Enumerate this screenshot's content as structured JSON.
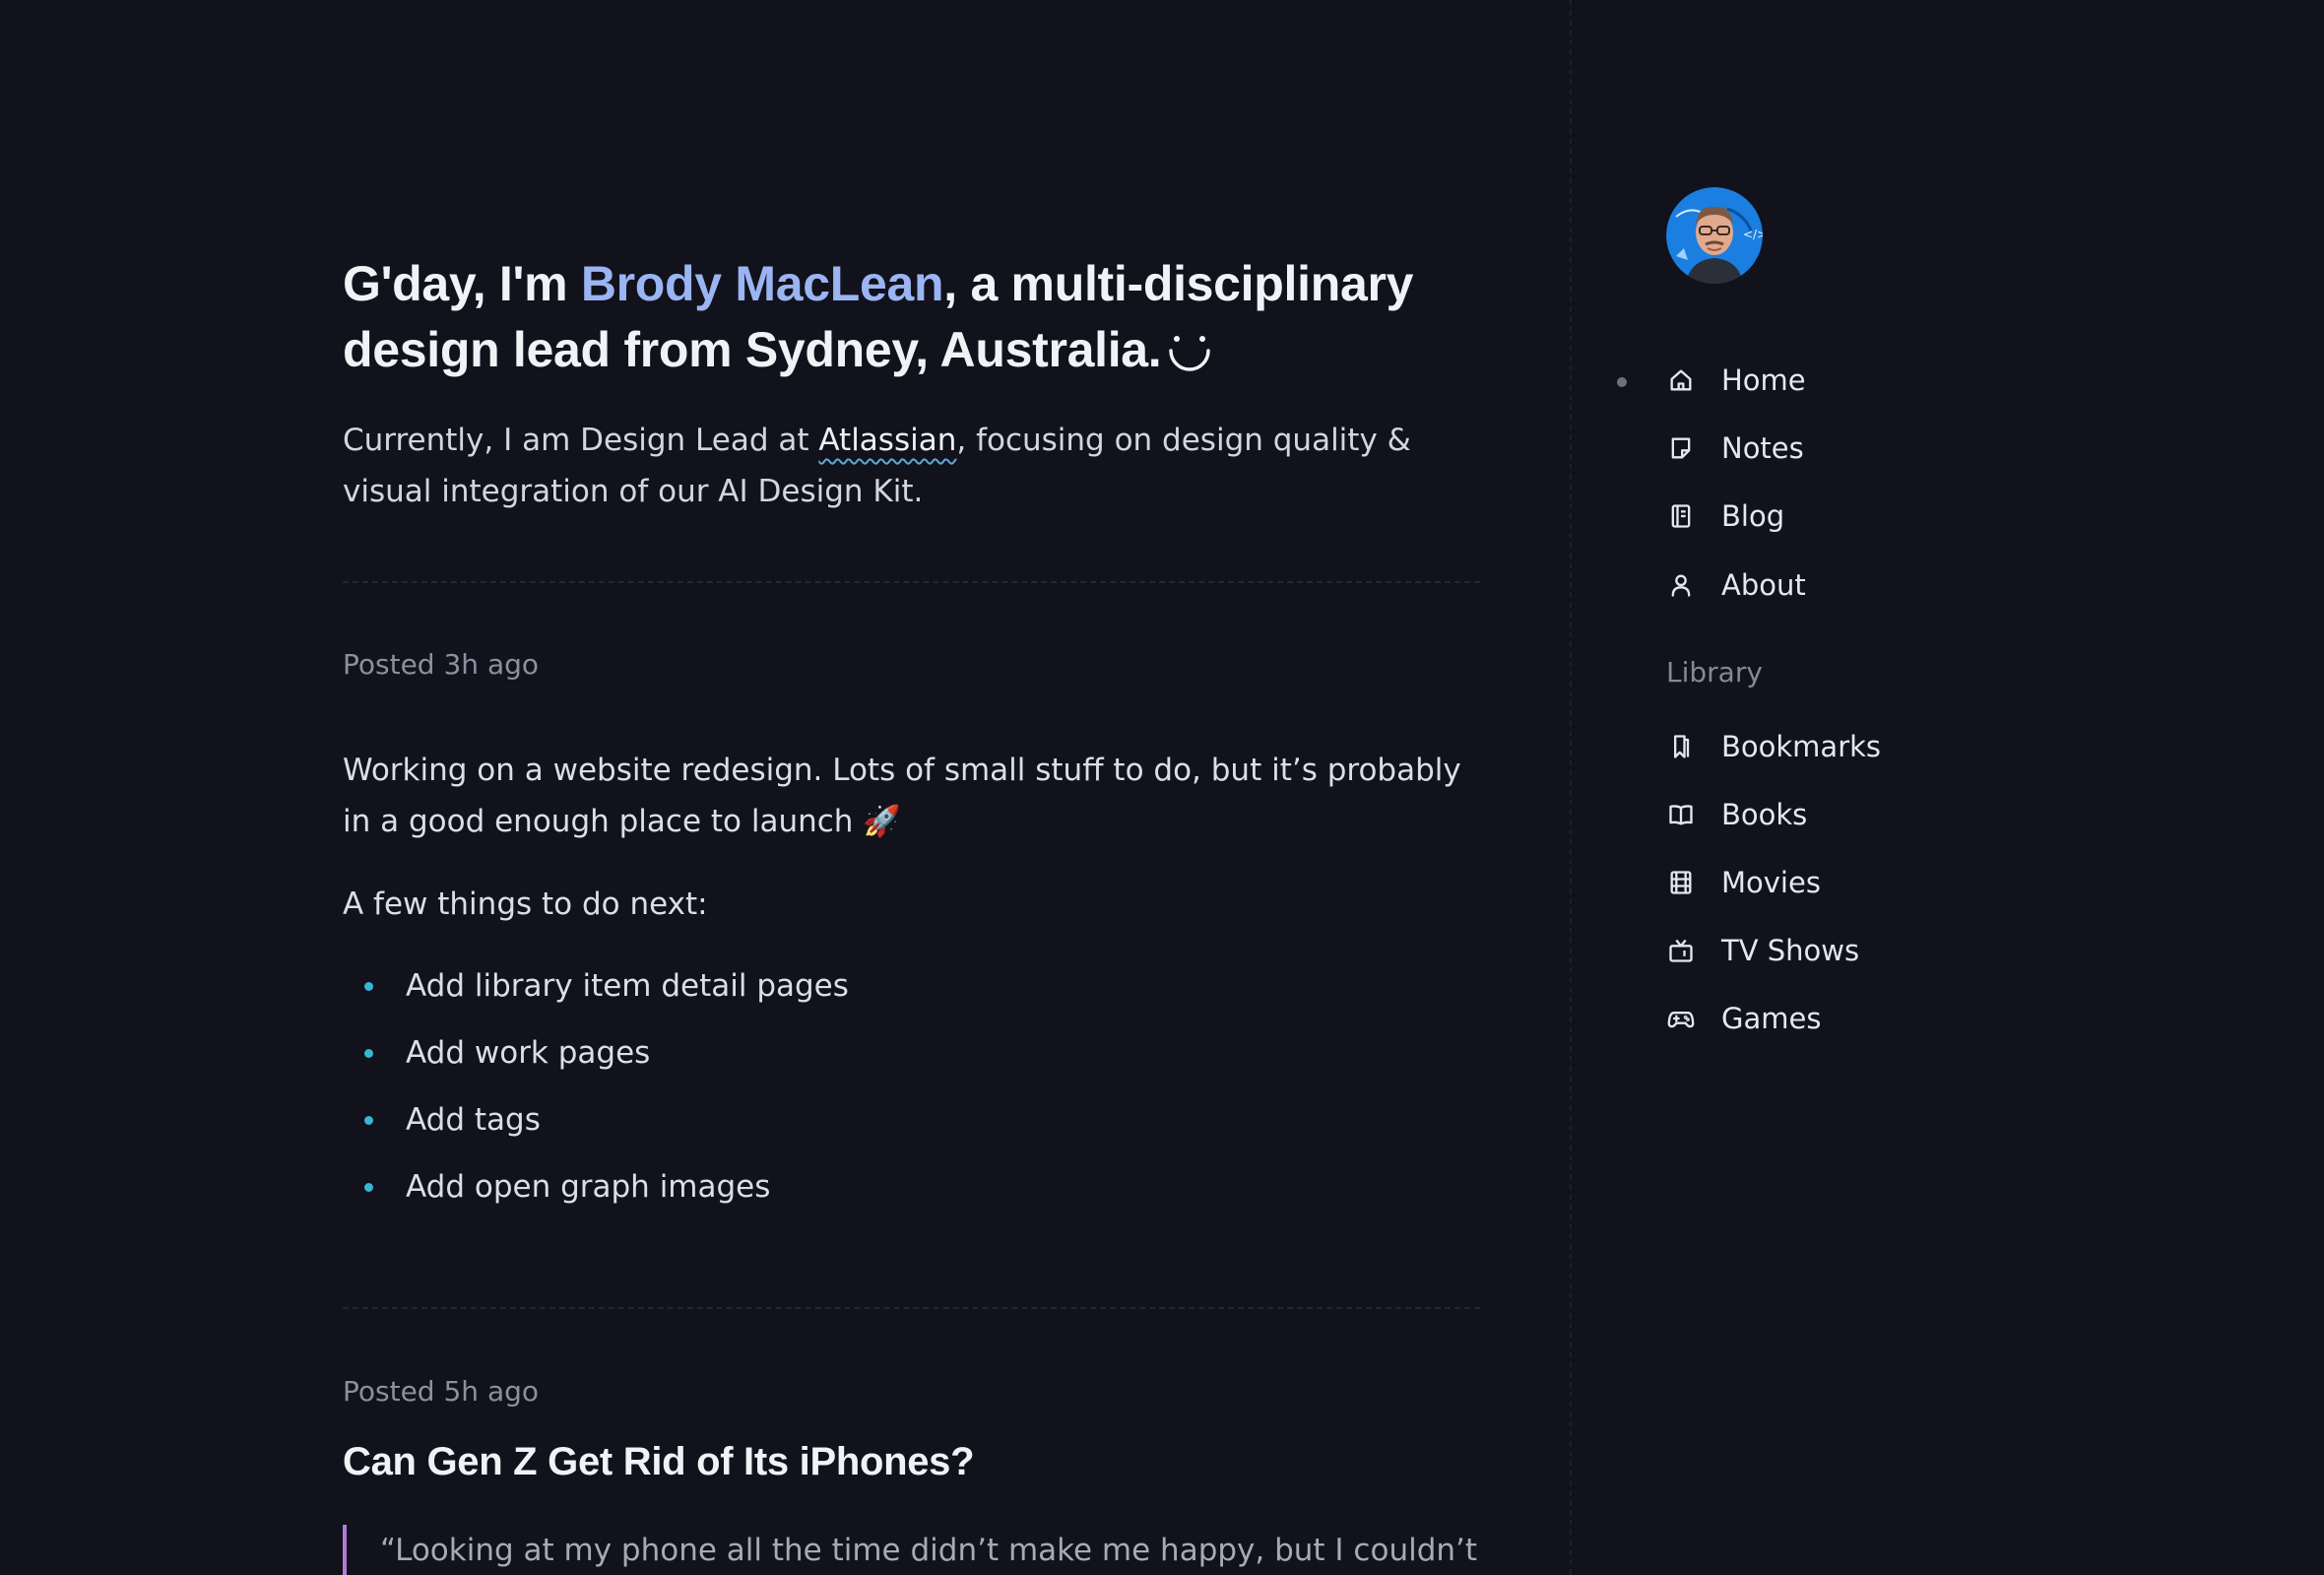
{
  "header": {
    "greeting_before": "G'day, I'm ",
    "name": "Brody MacLean",
    "greeting_after": ", a multi-disciplinary design lead from Sydney, Australia."
  },
  "intro": {
    "before": "Currently, I am Design Lead at ",
    "company": "Atlassian",
    "after": ", focusing on design quality & visual integration of our AI Design Kit."
  },
  "posts": [
    {
      "meta": "Posted 3h ago",
      "paragraph1": "Working on a website redesign. Lots of small stuff to do, but it’s probably in a good enough place to launch 🚀",
      "paragraph2": "A few things to do next:",
      "items": [
        "Add library item detail pages",
        "Add work pages",
        "Add tags",
        "Add open graph images"
      ]
    },
    {
      "meta": "Posted 5h ago",
      "title": "Can Gen Z Get Rid of Its iPhones?",
      "quote": "“Looking at my phone all the time didn’t make me happy, but I couldn’t"
    }
  ],
  "sidebar": {
    "nav": [
      {
        "label": "Home",
        "icon": "home-icon",
        "active": true
      },
      {
        "label": "Notes",
        "icon": "note-icon"
      },
      {
        "label": "Blog",
        "icon": "blog-icon"
      },
      {
        "label": "About",
        "icon": "user-icon"
      }
    ],
    "library_label": "Library",
    "library": [
      {
        "label": "Bookmarks",
        "icon": "bookmark-icon"
      },
      {
        "label": "Books",
        "icon": "book-icon"
      },
      {
        "label": "Movies",
        "icon": "film-icon"
      },
      {
        "label": "TV Shows",
        "icon": "tv-icon"
      },
      {
        "label": "Games",
        "icon": "gamepad-icon"
      }
    ]
  },
  "colors": {
    "background": "#11121c",
    "name_accent": "#9bb4f2",
    "bullet_accent": "#38b6d6",
    "quote_border": "#b57ad9"
  }
}
